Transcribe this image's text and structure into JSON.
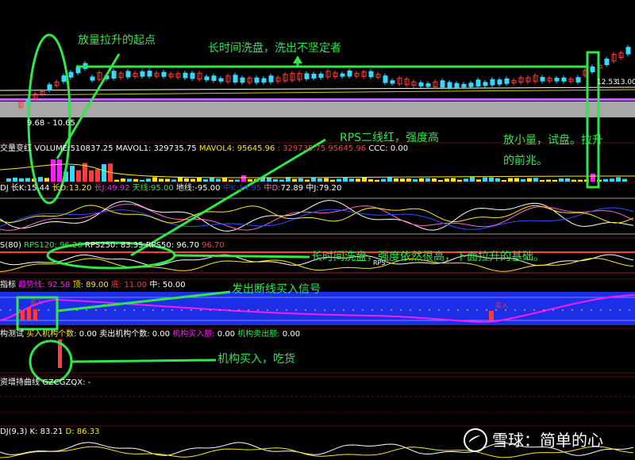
{
  "colors": {
    "green": "#2ee84a",
    "white": "#ffffff",
    "yellow": "#ffe81a",
    "magenta": "#ff1aff",
    "red": "#ff3b3b",
    "cyan": "#37d8ff",
    "blue": "#2a3bff",
    "pink": "#ff66cc",
    "gray": "#9c9c9c"
  },
  "price_panel": {
    "price_range_label": "9.68 - 10.65",
    "right_tick_label": "13.00",
    "right_tick_small": "12.53"
  },
  "volume_panel": {
    "title": "交量变红",
    "vol_label": "VOLUME:",
    "vol_value": "510837.25",
    "mavol1_label": "MAVOL1:",
    "mavol1_value": "329735.75",
    "mavol4_label": "MAVOL4:",
    "mavol4_value": "95645.96",
    "extra_value": "329735.75",
    "extra_value2": "95645.96",
    "ccc_label": "CCC:",
    "ccc_value": "0.00"
  },
  "kdj_panel": {
    "prefix": "DJ",
    "k_label": "长K:",
    "k_value": "15.44",
    "d_label": "长D:",
    "d_value": "13.20",
    "j_label": "长J:",
    "j_value": "49.92",
    "sky_label": "天线:",
    "sky_value": "95.00",
    "ground_label": "地线:",
    "ground_value": "-95.00",
    "hk_label": "中K:",
    "hk_value": "14.95",
    "hd_label": "中D:",
    "hd_value": "72.89",
    "hj_label": "中J:",
    "hj_value": "79.20"
  },
  "rps_panel": {
    "prefix": "S(80)",
    "rps120_label": "RPS120:",
    "rps120_value": "96.20",
    "rps250_label": "RPS250:",
    "rps250_value": "83.35",
    "rps50_label": "RPS50:",
    "rps50_value": "96.70",
    "rps_extra": "96.70",
    "small_tag": "RPS"
  },
  "signal_panel": {
    "prefix": "指标",
    "trend_label": "趋势线:",
    "trend_value": "92.58",
    "top_label": "顶:",
    "top_value": "89.00",
    "bottom_label": "底:",
    "bottom_value": "11.00",
    "mid_label": "中:",
    "mid_value": "50.00",
    "buy_tag_left": "买入",
    "buy_tag_right": "买入"
  },
  "inst_panel": {
    "prefix": "构测试",
    "buy_count_label": "买入机构个数:",
    "buy_count_value": "0.00",
    "sell_count_label": "卖出机构个数:",
    "sell_count_value": "0.00",
    "buy_amt_label": "机构买入额:",
    "buy_amt_value": "0.00",
    "sell_amt_label": "机构卖出额:",
    "sell_amt_value": "0.00"
  },
  "hold_panel": {
    "label": "资增持曲线",
    "code_label": "GZCGZQX:",
    "code_value": "-"
  },
  "kdj2_panel": {
    "prefix": "DJ(9,3)",
    "k_label": "K:",
    "k_value": "83.21",
    "d_label": "D:",
    "d_value": "86.33"
  },
  "annotations": {
    "start": "放量拉升的起点",
    "long_wash": "长时间洗盘，洗出不坚定者",
    "rps_red": "RPS二线红，强度高",
    "small_vol_1": "放小量，试盘。拉升",
    "small_vol_2": "的前兆。",
    "long_wash_rps": "长时间洗盘，强度依然很高，下面拉升的基础。",
    "break_signal": "发出断线买入信号",
    "inst_buy": "机构买入，吃货"
  },
  "watermark": {
    "text": "雪球：简单的心"
  }
}
